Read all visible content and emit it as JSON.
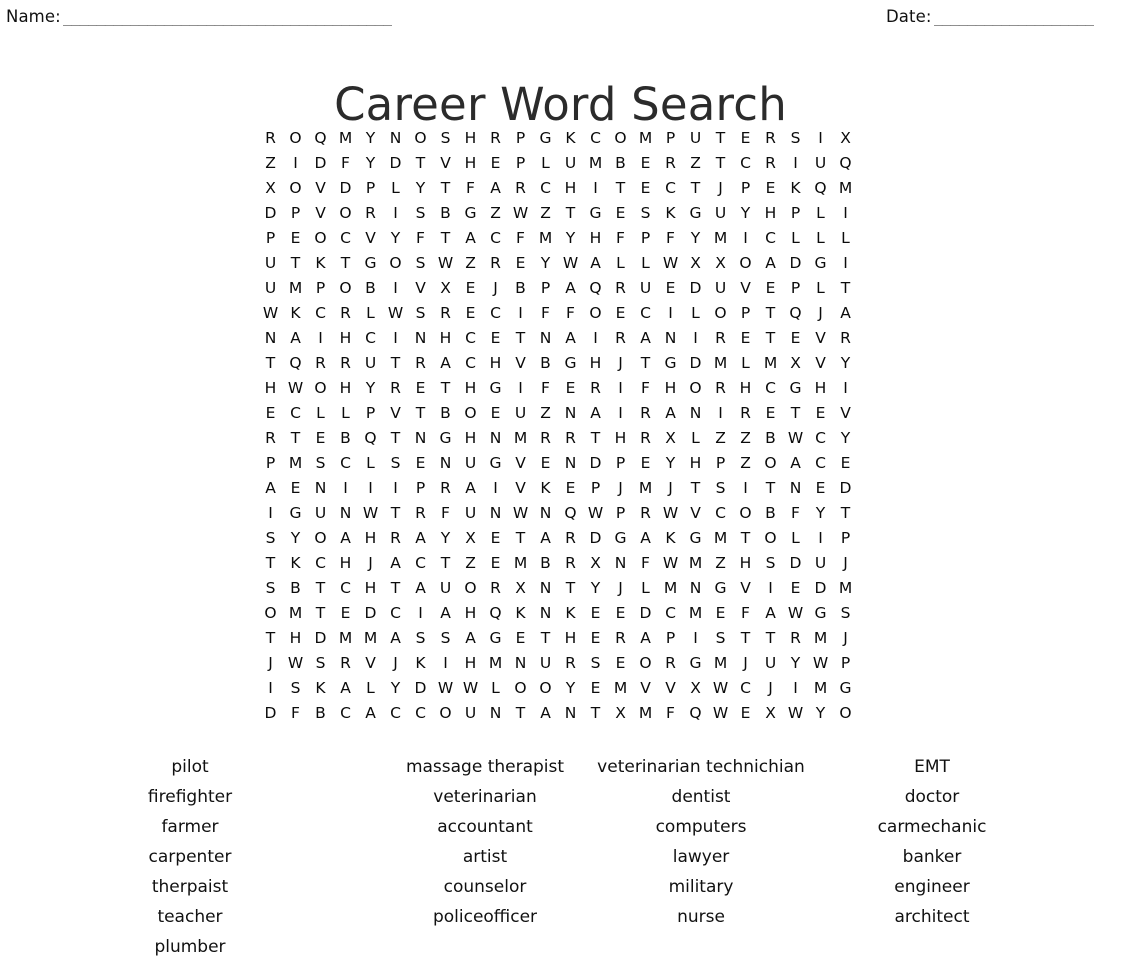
{
  "header": {
    "name_label": "Name:",
    "name_rule": "_______________________________________",
    "date_label": "Date:",
    "date_rule": "___________________"
  },
  "title": "Career Word Search",
  "grid": {
    "rows": 24,
    "cols": 24,
    "letters": [
      [
        "R",
        "O",
        "Q",
        "M",
        "Y",
        "N",
        "O",
        "S",
        "H",
        "R",
        "P",
        "G",
        "K",
        "C",
        "O",
        "M",
        "P",
        "U",
        "T",
        "E",
        "R",
        "S",
        "I",
        "X"
      ],
      [
        "Z",
        "I",
        "D",
        "F",
        "Y",
        "D",
        "T",
        "V",
        "H",
        "E",
        "P",
        "L",
        "U",
        "M",
        "B",
        "E",
        "R",
        "Z",
        "T",
        "C",
        "R",
        "I",
        "U",
        "Q"
      ],
      [
        "X",
        "O",
        "V",
        "D",
        "P",
        "L",
        "Y",
        "T",
        "F",
        "A",
        "R",
        "C",
        "H",
        "I",
        "T",
        "E",
        "C",
        "T",
        "J",
        "P",
        "E",
        "K",
        "Q",
        "M"
      ],
      [
        "D",
        "P",
        "V",
        "O",
        "R",
        "I",
        "S",
        "B",
        "G",
        "Z",
        "W",
        "Z",
        "T",
        "G",
        "E",
        "S",
        "K",
        "G",
        "U",
        "Y",
        "H",
        "P",
        "L",
        "I"
      ],
      [
        "P",
        "E",
        "O",
        "C",
        "V",
        "Y",
        "F",
        "T",
        "A",
        "C",
        "F",
        "M",
        "Y",
        "H",
        "F",
        "P",
        "F",
        "Y",
        "M",
        "I",
        "C",
        "L",
        "L",
        "L"
      ],
      [
        "U",
        "T",
        "K",
        "T",
        "G",
        "O",
        "S",
        "W",
        "Z",
        "R",
        "E",
        "Y",
        "W",
        "A",
        "L",
        "L",
        "W",
        "X",
        "X",
        "O",
        "A",
        "D",
        "G",
        "I"
      ],
      [
        "U",
        "M",
        "P",
        "O",
        "B",
        "I",
        "V",
        "X",
        "E",
        "J",
        "B",
        "P",
        "A",
        "Q",
        "R",
        "U",
        "E",
        "D",
        "U",
        "V",
        "E",
        "P",
        "L",
        "T"
      ],
      [
        "W",
        "K",
        "C",
        "R",
        "L",
        "W",
        "S",
        "R",
        "E",
        "C",
        "I",
        "F",
        "F",
        "O",
        "E",
        "C",
        "I",
        "L",
        "O",
        "P",
        "T",
        "Q",
        "J",
        "A"
      ],
      [
        "N",
        "A",
        "I",
        "H",
        "C",
        "I",
        "N",
        "H",
        "C",
        "E",
        "T",
        "N",
        "A",
        "I",
        "R",
        "A",
        "N",
        "I",
        "R",
        "E",
        "T",
        "E",
        "V",
        "R"
      ],
      [
        "T",
        "Q",
        "R",
        "R",
        "U",
        "T",
        "R",
        "A",
        "C",
        "H",
        "V",
        "B",
        "G",
        "H",
        "J",
        "T",
        "G",
        "D",
        "M",
        "L",
        "M",
        "X",
        "V",
        "Y"
      ],
      [
        "H",
        "W",
        "O",
        "H",
        "Y",
        "R",
        "E",
        "T",
        "H",
        "G",
        "I",
        "F",
        "E",
        "R",
        "I",
        "F",
        "H",
        "O",
        "R",
        "H",
        "C",
        "G",
        "H",
        "I"
      ],
      [
        "E",
        "C",
        "L",
        "L",
        "P",
        "V",
        "T",
        "B",
        "O",
        "E",
        "U",
        "Z",
        "N",
        "A",
        "I",
        "R",
        "A",
        "N",
        "I",
        "R",
        "E",
        "T",
        "E",
        "V"
      ],
      [
        "R",
        "T",
        "E",
        "B",
        "Q",
        "T",
        "N",
        "G",
        "H",
        "N",
        "M",
        "R",
        "R",
        "T",
        "H",
        "R",
        "X",
        "L",
        "Z",
        "Z",
        "B",
        "W",
        "C",
        "Y"
      ],
      [
        "P",
        "M",
        "S",
        "C",
        "L",
        "S",
        "E",
        "N",
        "U",
        "G",
        "V",
        "E",
        "N",
        "D",
        "P",
        "E",
        "Y",
        "H",
        "P",
        "Z",
        "O",
        "A",
        "C",
        "E"
      ],
      [
        "A",
        "E",
        "N",
        "I",
        "I",
        "I",
        "P",
        "R",
        "A",
        "I",
        "V",
        "K",
        "E",
        "P",
        "J",
        "M",
        "J",
        "T",
        "S",
        "I",
        "T",
        "N",
        "E",
        "D"
      ],
      [
        "I",
        "G",
        "U",
        "N",
        "W",
        "T",
        "R",
        "F",
        "U",
        "N",
        "W",
        "N",
        "Q",
        "W",
        "P",
        "R",
        "W",
        "V",
        "C",
        "O",
        "B",
        "F",
        "Y",
        "T"
      ],
      [
        "S",
        "Y",
        "O",
        "A",
        "H",
        "R",
        "A",
        "Y",
        "X",
        "E",
        "T",
        "A",
        "R",
        "D",
        "G",
        "A",
        "K",
        "G",
        "M",
        "T",
        "O",
        "L",
        "I",
        "P"
      ],
      [
        "T",
        "K",
        "C",
        "H",
        "J",
        "A",
        "C",
        "T",
        "Z",
        "E",
        "M",
        "B",
        "R",
        "X",
        "N",
        "F",
        "W",
        "M",
        "Z",
        "H",
        "S",
        "D",
        "U",
        "J"
      ],
      [
        "S",
        "B",
        "T",
        "C",
        "H",
        "T",
        "A",
        "U",
        "O",
        "R",
        "X",
        "N",
        "T",
        "Y",
        "J",
        "L",
        "M",
        "N",
        "G",
        "V",
        "I",
        "E",
        "D",
        "M"
      ],
      [
        "O",
        "M",
        "T",
        "E",
        "D",
        "C",
        "I",
        "A",
        "H",
        "Q",
        "K",
        "N",
        "K",
        "E",
        "E",
        "D",
        "C",
        "M",
        "E",
        "F",
        "A",
        "W",
        "G",
        "S"
      ],
      [
        "T",
        "H",
        "D",
        "M",
        "M",
        "A",
        "S",
        "S",
        "A",
        "G",
        "E",
        "T",
        "H",
        "E",
        "R",
        "A",
        "P",
        "I",
        "S",
        "T",
        "T",
        "R",
        "M",
        "J"
      ],
      [
        "J",
        "W",
        "S",
        "R",
        "V",
        "J",
        "K",
        "I",
        "H",
        "M",
        "N",
        "U",
        "R",
        "S",
        "E",
        "O",
        "R",
        "G",
        "M",
        "J",
        "U",
        "Y",
        "W",
        "P"
      ],
      [
        "I",
        "S",
        "K",
        "A",
        "L",
        "Y",
        "D",
        "W",
        "W",
        "L",
        "O",
        "O",
        "Y",
        "E",
        "M",
        "V",
        "V",
        "X",
        "W",
        "C",
        "J",
        "I",
        "M",
        "G"
      ],
      [
        "D",
        "F",
        "B",
        "C",
        "A",
        "C",
        "C",
        "O",
        "U",
        "N",
        "T",
        "A",
        "N",
        "T",
        "X",
        "M",
        "F",
        "Q",
        "W",
        "E",
        "X",
        "W",
        "Y",
        "O"
      ]
    ]
  },
  "word_list": {
    "rows": [
      [
        "pilot",
        "massage therapist",
        "veterinarian technichian",
        "EMT"
      ],
      [
        "firefighter",
        "veterinarian",
        "dentist",
        "doctor"
      ],
      [
        "farmer",
        "accountant",
        "computers",
        "carmechanic"
      ],
      [
        "carpenter",
        "artist",
        "lawyer",
        "banker"
      ],
      [
        "therpaist",
        "counselor",
        "military",
        "engineer"
      ],
      [
        "teacher",
        "policeofficer",
        "nurse",
        "architect"
      ],
      [
        "plumber",
        "",
        "",
        ""
      ]
    ]
  }
}
